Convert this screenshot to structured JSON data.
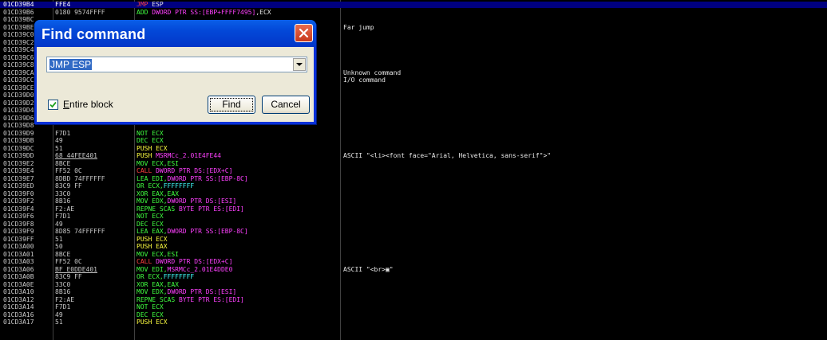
{
  "colors": {
    "jump": "#ff4040",
    "call": "#ff4040",
    "push": "#ffff40",
    "stack_op": "#ffff40",
    "mov": "#40ff40",
    "arith": "#40ff40",
    "xor": "#40ff40",
    "lea": "#40ff40",
    "scas": "#40ff40",
    "mem": "#ff40ff",
    "const": "#40ffff",
    "plain": "#e8e8e8",
    "selection": "#000080"
  },
  "disassembly": {
    "rows": [
      {
        "addr": "01CD39B4",
        "hex": "FFE4",
        "dis": [
          [
            "JMP",
            "jump"
          ],
          [
            " ESP",
            "plain"
          ]
        ],
        "comment": "",
        "sel": true
      },
      {
        "addr": "01CD39B6",
        "hex": "0180 9574FFFF",
        "dis": [
          [
            "ADD ",
            "arith"
          ],
          [
            "DWORD PTR SS:[EBP+FFFF7495]",
            "mem"
          ],
          [
            ",ECX",
            "plain"
          ]
        ],
        "comment": ""
      },
      {
        "addr": "01CD39BC",
        "hex": "",
        "dis": [],
        "comment": ""
      },
      {
        "addr": "01CD39BE",
        "hex": "",
        "dis": [],
        "comment": "Far jump"
      },
      {
        "addr": "01CD39C0",
        "hex": "",
        "dis": [],
        "comment": ""
      },
      {
        "addr": "01CD39C2",
        "hex": "",
        "dis": [],
        "comment": ""
      },
      {
        "addr": "01CD39C4",
        "hex": "",
        "dis": [],
        "comment": ""
      },
      {
        "addr": "01CD39C6",
        "hex": "",
        "dis": [],
        "comment": ""
      },
      {
        "addr": "01CD39C8",
        "hex": "",
        "dis": [],
        "comment": ""
      },
      {
        "addr": "01CD39CA",
        "hex": "",
        "dis": [],
        "comment": "Unknown command"
      },
      {
        "addr": "01CD39CC",
        "hex": "",
        "dis": [],
        "comment": "I/O command"
      },
      {
        "addr": "01CD39CE",
        "hex": "",
        "dis": [],
        "comment": ""
      },
      {
        "addr": "01CD39D0",
        "hex": "",
        "dis": [],
        "comment": ""
      },
      {
        "addr": "01CD39D2",
        "hex": "",
        "dis": [],
        "comment": ""
      },
      {
        "addr": "01CD39D4",
        "hex": "",
        "dis": [],
        "comment": ""
      },
      {
        "addr": "01CD39D6",
        "hex": "",
        "dis": [],
        "comment": ""
      },
      {
        "addr": "01CD39D8",
        "hex": "",
        "dis": [],
        "comment": ""
      },
      {
        "addr": "01CD39D9",
        "hex": "F7D1",
        "dis": [
          [
            "NOT ECX",
            "arith"
          ]
        ],
        "comment": ""
      },
      {
        "addr": "01CD39DB",
        "hex": "49",
        "dis": [
          [
            "DEC ECX",
            "arith"
          ]
        ],
        "comment": ""
      },
      {
        "addr": "01CD39DC",
        "hex": "51",
        "dis": [
          [
            "PUSH ECX",
            "push"
          ]
        ],
        "comment": ""
      },
      {
        "addr": "01CD39DD",
        "hex": "68 44FEE401",
        "hexu": true,
        "dis": [
          [
            "PUSH ",
            "push"
          ],
          [
            "MSRMCc_2.01E4FE44",
            "mem"
          ]
        ],
        "comment": "ASCII \"<li><font face=\"Arial, Helvetica, sans-serif\">\""
      },
      {
        "addr": "01CD39E2",
        "hex": "8BCE",
        "dis": [
          [
            "MOV ECX,ESI",
            "mov"
          ]
        ],
        "comment": ""
      },
      {
        "addr": "01CD39E4",
        "hex": "FF52 0C",
        "dis": [
          [
            "CALL ",
            "call"
          ],
          [
            "DWORD PTR DS:[EDX+C]",
            "mem"
          ]
        ],
        "comment": ""
      },
      {
        "addr": "01CD39E7",
        "hex": "8DBD 74FFFFFF",
        "dis": [
          [
            "LEA EDI,",
            "lea"
          ],
          [
            "DWORD PTR SS:[EBP-8C]",
            "mem"
          ]
        ],
        "comment": ""
      },
      {
        "addr": "01CD39ED",
        "hex": "83C9 FF",
        "dis": [
          [
            "OR ECX,",
            "arith"
          ],
          [
            "FFFFFFFF",
            "const"
          ]
        ],
        "comment": ""
      },
      {
        "addr": "01CD39F0",
        "hex": "33C0",
        "dis": [
          [
            "XOR EAX,EAX",
            "xor"
          ]
        ],
        "comment": ""
      },
      {
        "addr": "01CD39F2",
        "hex": "8B16",
        "dis": [
          [
            "MOV EDX,",
            "mov"
          ],
          [
            "DWORD PTR DS:[ESI]",
            "mem"
          ]
        ],
        "comment": ""
      },
      {
        "addr": "01CD39F4",
        "hex": "F2:AE",
        "dis": [
          [
            "REPNE SCAS ",
            "scas"
          ],
          [
            "BYTE PTR ES:[EDI]",
            "mem"
          ]
        ],
        "comment": ""
      },
      {
        "addr": "01CD39F6",
        "hex": "F7D1",
        "dis": [
          [
            "NOT ECX",
            "arith"
          ]
        ],
        "comment": ""
      },
      {
        "addr": "01CD39F8",
        "hex": "49",
        "dis": [
          [
            "DEC ECX",
            "arith"
          ]
        ],
        "comment": ""
      },
      {
        "addr": "01CD39F9",
        "hex": "8D85 74FFFFFF",
        "dis": [
          [
            "LEA EAX,",
            "lea"
          ],
          [
            "DWORD PTR SS:[EBP-8C]",
            "mem"
          ]
        ],
        "comment": ""
      },
      {
        "addr": "01CD39FF",
        "hex": "51",
        "dis": [
          [
            "PUSH ECX",
            "push"
          ]
        ],
        "comment": ""
      },
      {
        "addr": "01CD3A00",
        "hex": "50",
        "dis": [
          [
            "PUSH EAX",
            "push"
          ]
        ],
        "comment": ""
      },
      {
        "addr": "01CD3A01",
        "hex": "8BCE",
        "dis": [
          [
            "MOV ECX,ESI",
            "mov"
          ]
        ],
        "comment": ""
      },
      {
        "addr": "01CD3A03",
        "hex": "FF52 0C",
        "dis": [
          [
            "CALL ",
            "call"
          ],
          [
            "DWORD PTR DS:[EDX+C]",
            "mem"
          ]
        ],
        "comment": ""
      },
      {
        "addr": "01CD3A06",
        "hex": "BF E0DDE401",
        "hexu": true,
        "dis": [
          [
            "MOV EDI,",
            "mov"
          ],
          [
            "MSRMCc_2.01E4DDE0",
            "mem"
          ]
        ],
        "comment": "ASCII \"<br>▣\""
      },
      {
        "addr": "01CD3A0B",
        "hex": "83C9 FF",
        "dis": [
          [
            "OR ECX,",
            "arith"
          ],
          [
            "FFFFFFFF",
            "const"
          ]
        ],
        "comment": ""
      },
      {
        "addr": "01CD3A0E",
        "hex": "33C0",
        "dis": [
          [
            "XOR EAX,EAX",
            "xor"
          ]
        ],
        "comment": ""
      },
      {
        "addr": "01CD3A10",
        "hex": "8B16",
        "dis": [
          [
            "MOV EDX,",
            "mov"
          ],
          [
            "DWORD PTR DS:[ESI]",
            "mem"
          ]
        ],
        "comment": ""
      },
      {
        "addr": "01CD3A12",
        "hex": "F2:AE",
        "dis": [
          [
            "REPNE SCAS ",
            "scas"
          ],
          [
            "BYTE PTR ES:[EDI]",
            "mem"
          ]
        ],
        "comment": ""
      },
      {
        "addr": "01CD3A14",
        "hex": "F7D1",
        "dis": [
          [
            "NOT ECX",
            "arith"
          ]
        ],
        "comment": ""
      },
      {
        "addr": "01CD3A16",
        "hex": "49",
        "dis": [
          [
            "DEC ECX",
            "arith"
          ]
        ],
        "comment": ""
      },
      {
        "addr": "01CD3A17",
        "hex": "51",
        "dis": [
          [
            "PUSH ECX",
            "push"
          ]
        ],
        "comment": ""
      }
    ]
  },
  "find_dialog": {
    "title": "Find command",
    "close_icon": "close-x-icon",
    "command_value": "JMP ESP",
    "dropdown_icon": "chevron-down-icon",
    "entire_block_checked": true,
    "entire_block_mnemonic": "E",
    "entire_block_rest": "ntire block",
    "find_label": "Find",
    "cancel_label": "Cancel"
  }
}
